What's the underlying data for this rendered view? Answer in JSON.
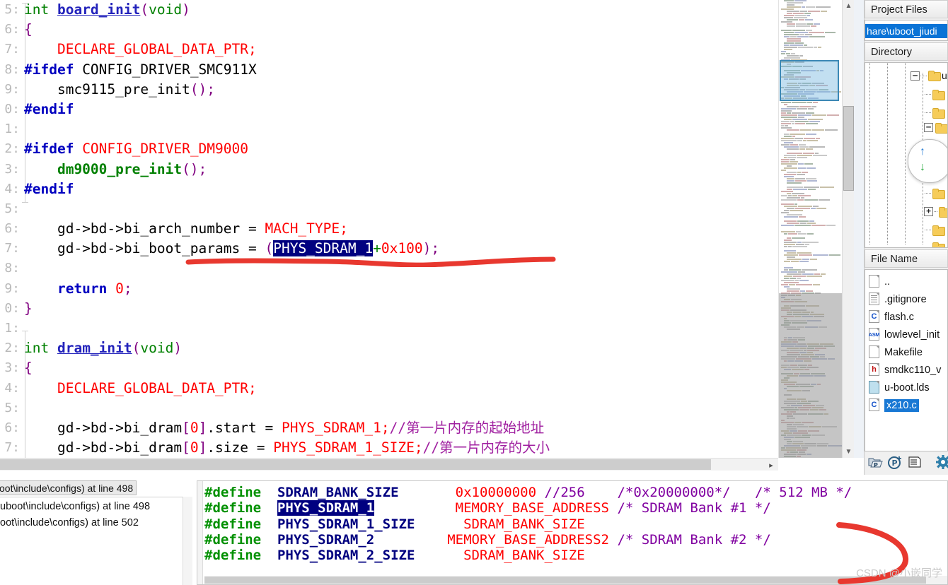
{
  "editor": {
    "line_numbers": [
      "5:",
      "6:",
      "7:",
      "8:",
      "9:",
      "0:",
      "1:",
      "2:",
      "3:",
      "4:",
      "5:",
      "6:",
      "7:",
      "8:",
      "9:",
      "0:",
      "1:",
      "2:",
      "3:",
      "4:",
      "5:",
      "6:",
      "7:"
    ],
    "lines": [
      {
        "n": "5:",
        "tokens": [
          {
            "t": "int ",
            "c": "k-green"
          },
          {
            "t": "board_init",
            "c": "k-fn"
          },
          {
            "t": "(",
            "c": "k-purple"
          },
          {
            "t": "void",
            "c": "k-green"
          },
          {
            "t": ")",
            "c": "k-purple"
          }
        ]
      },
      {
        "n": "6:",
        "tokens": [
          {
            "t": "{",
            "c": "k-purple"
          }
        ]
      },
      {
        "n": "7:",
        "tokens": [
          {
            "t": "    DECLARE_GLOBAL_DATA_PTR",
            "c": "k-red"
          },
          {
            "t": ";",
            "c": "k-red"
          }
        ]
      },
      {
        "n": "8:",
        "tokens": [
          {
            "t": "#ifdef",
            "c": "k-blue"
          },
          {
            "t": " CONFIG_DRIVER_SMC911X",
            "c": "k-black"
          }
        ]
      },
      {
        "n": "9:",
        "tokens": [
          {
            "t": "    smc9115_pre_init",
            "c": "k-black"
          },
          {
            "t": "();",
            "c": "k-purple"
          }
        ]
      },
      {
        "n": "0:",
        "tokens": [
          {
            "t": "#endif",
            "c": "k-blue"
          }
        ]
      },
      {
        "n": "1:",
        "tokens": [
          {
            "t": "",
            "c": "k-black"
          }
        ]
      },
      {
        "n": "2:",
        "tokens": [
          {
            "t": "#ifdef",
            "c": "k-blue"
          },
          {
            "t": " CONFIG_DRIVER_DM9000",
            "c": "k-red"
          }
        ]
      },
      {
        "n": "3:",
        "tokens": [
          {
            "t": "    dm9000_pre_init",
            "c": "k-green2"
          },
          {
            "t": "();",
            "c": "k-purple"
          }
        ]
      },
      {
        "n": "4:",
        "tokens": [
          {
            "t": "#endif",
            "c": "k-blue"
          }
        ]
      },
      {
        "n": "5:",
        "tokens": [
          {
            "t": "",
            "c": "k-black"
          }
        ]
      },
      {
        "n": "6:",
        "tokens": [
          {
            "t": "    gd->bd->bi_arch_number = ",
            "c": "k-black"
          },
          {
            "t": "MACH_TYPE",
            "c": "k-red"
          },
          {
            "t": ";",
            "c": "k-red"
          }
        ]
      },
      {
        "n": "7:",
        "tokens": [
          {
            "t": "    gd->bd->bi_boot_params = ",
            "c": "k-black"
          },
          {
            "t": "(",
            "c": "k-purple"
          },
          {
            "t": "PHYS_SDRAM_1",
            "c": "sel"
          },
          {
            "t": "+",
            "c": "k-green"
          },
          {
            "t": "0x100",
            "c": "k-red"
          },
          {
            "t": ")",
            "c": "k-purple"
          },
          {
            "t": ";",
            "c": "k-purple"
          }
        ]
      },
      {
        "n": "8:",
        "tokens": [
          {
            "t": "",
            "c": "k-black"
          }
        ]
      },
      {
        "n": "9:",
        "tokens": [
          {
            "t": "    return",
            "c": "k-blue"
          },
          {
            "t": " ",
            "c": "k-black"
          },
          {
            "t": "0",
            "c": "k-red"
          },
          {
            "t": ";",
            "c": "k-purple"
          }
        ]
      },
      {
        "n": "0:",
        "tokens": [
          {
            "t": "}",
            "c": "k-purple"
          }
        ]
      },
      {
        "n": "1:",
        "tokens": [
          {
            "t": "",
            "c": "k-black"
          }
        ]
      },
      {
        "n": "2:",
        "tokens": [
          {
            "t": "int ",
            "c": "k-green"
          },
          {
            "t": "dram_init",
            "c": "k-fn"
          },
          {
            "t": "(",
            "c": "k-purple"
          },
          {
            "t": "void",
            "c": "k-green"
          },
          {
            "t": ")",
            "c": "k-purple"
          }
        ]
      },
      {
        "n": "3:",
        "tokens": [
          {
            "t": "{",
            "c": "k-purple"
          }
        ]
      },
      {
        "n": "4:",
        "tokens": [
          {
            "t": "    DECLARE_GLOBAL_DATA_PTR;",
            "c": "k-red"
          }
        ]
      },
      {
        "n": "5:",
        "tokens": [
          {
            "t": "",
            "c": "k-black"
          }
        ]
      },
      {
        "n": "6:",
        "tokens": [
          {
            "t": "    gd->bd->bi_dram",
            "c": "k-black"
          },
          {
            "t": "[",
            "c": "k-purple"
          },
          {
            "t": "0",
            "c": "k-red"
          },
          {
            "t": "]",
            "c": "k-purple"
          },
          {
            "t": ".start = ",
            "c": "k-black"
          },
          {
            "t": "PHYS_SDRAM_1",
            "c": "k-red"
          },
          {
            "t": ";",
            "c": "k-red"
          },
          {
            "t": "//第一片内存的起始地址",
            "c": "k-cmt"
          }
        ]
      },
      {
        "n": "7:",
        "tokens": [
          {
            "t": "    gd->bd->bi_dram",
            "c": "k-black"
          },
          {
            "t": "[",
            "c": "k-purple"
          },
          {
            "t": "0",
            "c": "k-red"
          },
          {
            "t": "]",
            "c": "k-purple"
          },
          {
            "t": ".size = ",
            "c": "k-black"
          },
          {
            "t": "PHYS_SDRAM_1_SIZE",
            "c": "k-red"
          },
          {
            "t": ";",
            "c": "k-red"
          },
          {
            "t": "//第一片内存的大小",
            "c": "k-cmt"
          }
        ]
      }
    ]
  },
  "right_panel": {
    "project_files_header": "Project Files",
    "project_path": "hare\\uboot_jiudi",
    "directory_header": "Directory",
    "directory_root_label": "ub",
    "file_name_header": "File Name",
    "files": [
      {
        "name": "..",
        "icon": "blank-file-icon",
        "letter": "",
        "selected": false
      },
      {
        "name": ".gitignore",
        "icon": "text-file-icon",
        "letter": "",
        "selected": false
      },
      {
        "name": "flash.c",
        "icon": "c-file-icon",
        "letter": "C",
        "selected": false
      },
      {
        "name": "lowlevel_init",
        "icon": "asm-file-icon",
        "letter": "ASM",
        "selected": false
      },
      {
        "name": "Makefile",
        "icon": "blank-file-icon",
        "letter": "",
        "selected": false
      },
      {
        "name": "smdkc110_v",
        "icon": "h-file-icon",
        "letter": "h",
        "selected": false
      },
      {
        "name": "u-boot.lds",
        "icon": "lds-file-icon",
        "letter": "",
        "selected": false
      },
      {
        "name": "x210.c",
        "icon": "c-file-icon",
        "letter": "C",
        "selected": true
      }
    ],
    "toolbar_icons": [
      "add-project-icon",
      "new-project-icon",
      "list-view-icon",
      "settings-gear-icon"
    ]
  },
  "bottom_left": {
    "tab_label": "oot\\include\\configs) at line 498",
    "rows": [
      "uboot\\include\\configs) at line 498",
      "oot\\include\\configs) at line 502"
    ]
  },
  "bottom_code": {
    "lines": [
      {
        "tokens": [
          {
            "t": "#define",
            "c": "bc-green"
          },
          {
            "t": "  ",
            "c": "bc-black"
          },
          {
            "t": "SDRAM_BANK_SIZE",
            "c": "bc-navy"
          },
          {
            "t": "       ",
            "c": "bc-black"
          },
          {
            "t": "0x10000000",
            "c": "bc-red"
          },
          {
            "t": " ",
            "c": "bc-black"
          },
          {
            "t": "//256",
            "c": "bc-purple"
          },
          {
            "t": "    ",
            "c": "bc-black"
          },
          {
            "t": "/*0x20000000*/",
            "c": "bc-purple"
          },
          {
            "t": "   ",
            "c": "bc-black"
          },
          {
            "t": "/* 512 MB */",
            "c": "bc-purple"
          }
        ]
      },
      {
        "tokens": [
          {
            "t": "#define",
            "c": "bc-green"
          },
          {
            "t": "  ",
            "c": "bc-black"
          },
          {
            "t": "PHYS_SDRAM_1",
            "c": "bc-sel"
          },
          {
            "t": "          ",
            "c": "bc-black"
          },
          {
            "t": "MEMORY_BASE_ADDRESS",
            "c": "bc-red"
          },
          {
            "t": " ",
            "c": "bc-black"
          },
          {
            "t": "/* SDRAM Bank #1 */",
            "c": "bc-purple"
          }
        ]
      },
      {
        "tokens": [
          {
            "t": "#define",
            "c": "bc-green"
          },
          {
            "t": "  ",
            "c": "bc-black"
          },
          {
            "t": "PHYS_SDRAM_1_SIZE",
            "c": "bc-navy"
          },
          {
            "t": "      ",
            "c": "bc-black"
          },
          {
            "t": "SDRAM_BANK_SIZE",
            "c": "bc-red"
          }
        ]
      },
      {
        "tokens": [
          {
            "t": "#define",
            "c": "bc-green"
          },
          {
            "t": "  ",
            "c": "bc-black"
          },
          {
            "t": "PHYS_SDRAM_2",
            "c": "bc-navy"
          },
          {
            "t": "         ",
            "c": "bc-black"
          },
          {
            "t": "MEMORY_BASE_ADDRESS2",
            "c": "bc-red"
          },
          {
            "t": " ",
            "c": "bc-black"
          },
          {
            "t": "/* SDRAM Bank #2 */",
            "c": "bc-purple"
          }
        ]
      },
      {
        "tokens": [
          {
            "t": "#define",
            "c": "bc-green"
          },
          {
            "t": "  ",
            "c": "bc-black"
          },
          {
            "t": "PHYS_SDRAM_2_SIZE",
            "c": "bc-navy"
          },
          {
            "t": "      ",
            "c": "bc-black"
          },
          {
            "t": "SDRAM_BANK_SIZE",
            "c": "bc-red"
          }
        ]
      }
    ]
  },
  "watermark": "CSDN @小嵌同学",
  "colors": {
    "keyword_blue": "#0000c0",
    "string_green": "#008000",
    "macro_red": "#ff0000",
    "punct_purple": "#800080",
    "selection_navy": "#000080",
    "comment_magenta": "#a020a0",
    "annotation_red": "#e8382f",
    "tree_select_blue": "#1878d4"
  }
}
